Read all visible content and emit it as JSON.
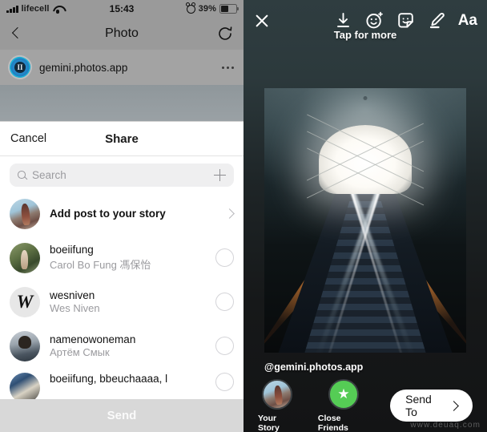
{
  "left": {
    "status_bar": {
      "carrier": "lifecell",
      "time": "15:43",
      "battery_percent": "39%",
      "signal_icon": "signal-bars-icon",
      "wifi_icon": "wifi-icon",
      "alarm_icon": "alarm-clock-icon",
      "battery_icon": "battery-icon"
    },
    "nav": {
      "back_icon": "chevron-left-icon",
      "title": "Photo",
      "refresh_icon": "refresh-icon"
    },
    "app_bar": {
      "app_icon": "gemini-photos-app-icon",
      "app_name": "gemini.photos.app",
      "more_icon": "more-horizontal-icon"
    },
    "sheet": {
      "cancel_label": "Cancel",
      "title": "Share",
      "search": {
        "icon": "search-icon",
        "placeholder": "Search",
        "value": "",
        "add_icon": "plus-icon"
      },
      "rows": [
        {
          "avatar": "your-story-avatar",
          "title": "Add post to your story",
          "subtitle": "",
          "bold": true,
          "trailing": "chevron-right-icon"
        },
        {
          "avatar": "boeiifung-avatar",
          "title": "boeiifung",
          "subtitle": "Carol Bo Fung 馮保怡",
          "bold": false,
          "trailing": "select-radio"
        },
        {
          "avatar": "wesniven-avatar",
          "title": "wesniven",
          "subtitle": "Wes Niven",
          "bold": false,
          "trailing": "select-radio"
        },
        {
          "avatar": "namenowoneman-avatar",
          "title": "namenowoneman",
          "subtitle": "Артём Смык",
          "bold": false,
          "trailing": "select-radio"
        },
        {
          "avatar": "boeiifung-bbeuchaaaa-avatar",
          "title": "boeiifung, bbeuchaaaa, l",
          "subtitle": "",
          "bold": false,
          "trailing": "select-radio"
        }
      ],
      "send_label": "Send"
    }
  },
  "right": {
    "toolbar": {
      "close_icon": "close-icon",
      "tools": [
        {
          "icon": "download-icon",
          "label": ""
        },
        {
          "icon": "sticker-face-icon",
          "label": ""
        },
        {
          "icon": "sticker-square-icon",
          "label": ""
        },
        {
          "icon": "draw-pen-icon",
          "label": ""
        },
        {
          "icon": "text-aa-icon",
          "label": "Aa"
        }
      ],
      "hint": "Tap for more"
    },
    "photo": {
      "name": "story-photo-preview",
      "description": "escalator-tunnel-photo"
    },
    "handle": "@gemini.photos.app",
    "destinations": [
      {
        "icon": "your-story-avatar",
        "label": "Your Story"
      },
      {
        "icon": "close-friends-star-icon",
        "label": "Close Friends"
      }
    ],
    "send_to": {
      "label": "Send To",
      "icon": "chevron-right-icon"
    },
    "watermark": "www.deuaq.com"
  },
  "colors": {
    "close_friends_green": "#55cc55",
    "sheet_white": "#ffffff",
    "right_panel_dark": "#1e2527",
    "status_bar_gray": "#9a9a9a"
  }
}
